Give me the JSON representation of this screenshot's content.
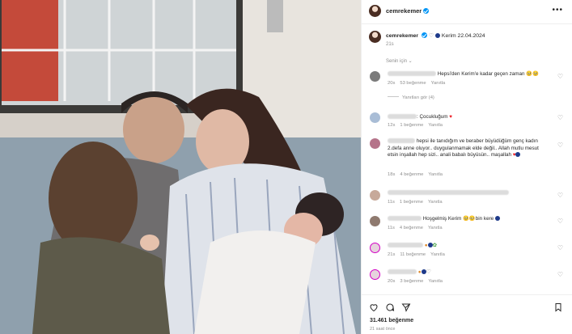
{
  "post": {
    "username": "cemrekemer",
    "more_icon": "more-horizontal-icon",
    "caption_text": "Kerim 22.04.2024",
    "caption_time": "21s",
    "sort_label": "Senin için ⌄",
    "likes": "31.461 beğenme",
    "posted_ago": "21 saat önce"
  },
  "comments": [
    {
      "text": "Hepsi'den Kerim'e kadar geçen zaman 🥺🥺",
      "time": "20s",
      "likes": "53 beğenme",
      "reply": "Yanıtla",
      "view_replies": "Yanıtları gör (4)"
    },
    {
      "text": ": Çocukluğum",
      "time": "12s",
      "likes": "1 beğenme",
      "reply": "Yanıtla"
    },
    {
      "text": "hepsi ile tanıdığım ve beraber büyüdüğüm genç kadın 2.defa anne oluyor.. duygulanmamak elde değil.. Allah mutlu mesut etsin inşallah hep sizi.. anali babalı büyüsün.. maşallah",
      "time": "18s",
      "likes": "4 beğenme",
      "reply": "Yanıtla"
    },
    {
      "text": "",
      "time": "11s",
      "likes": "1 beğenme",
      "reply": "Yanıtla"
    },
    {
      "text": "Hoşgelmiş Kerim 🥺🥺bin kere",
      "time": "11s",
      "likes": "4 beğenme",
      "reply": "Yanıtla"
    },
    {
      "text": "",
      "time": "21s",
      "likes": "11 beğenme",
      "reply": "Yanıtla"
    },
    {
      "text": "",
      "time": "20s",
      "likes": "3 beğenme",
      "reply": "Yanıtla"
    }
  ],
  "icons": [
    "heart-icon",
    "comment-icon",
    "share-icon",
    "bookmark-icon"
  ]
}
